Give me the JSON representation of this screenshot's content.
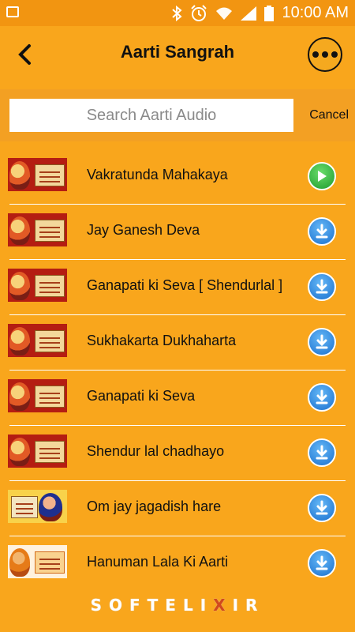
{
  "status_bar": {
    "time": "10:00 AM"
  },
  "header": {
    "title": "Aarti Sangrah"
  },
  "search": {
    "placeholder": "Search Aarti Audio",
    "cancel_label": "Cancel"
  },
  "aarti_list": [
    {
      "title": "Vakratunda Mahakaya",
      "action": "play",
      "thumb": "ganesh"
    },
    {
      "title": "Jay Ganesh Deva",
      "action": "download",
      "thumb": "ganesh"
    },
    {
      "title": "Ganapati ki Seva [ Shendurlal ]",
      "action": "download",
      "thumb": "ganesh"
    },
    {
      "title": "Sukhakarta Dukhaharta",
      "action": "download",
      "thumb": "ganesh"
    },
    {
      "title": "Ganapati ki Seva",
      "action": "download",
      "thumb": "ganesh"
    },
    {
      "title": "Shendur lal chadhayo",
      "action": "download",
      "thumb": "ganesh"
    },
    {
      "title": "Om jay jagadish hare",
      "action": "download",
      "thumb": "om"
    },
    {
      "title": "Hanuman Lala Ki Aarti",
      "action": "download",
      "thumb": "han"
    }
  ],
  "footer": {
    "brand_left": "SOFTELI",
    "brand_x": "X",
    "brand_right": "IR"
  },
  "colors": {
    "background": "#f9a61c",
    "status_bar": "#f29511",
    "play": "#1d9b2e",
    "download": "#1a6fce"
  }
}
